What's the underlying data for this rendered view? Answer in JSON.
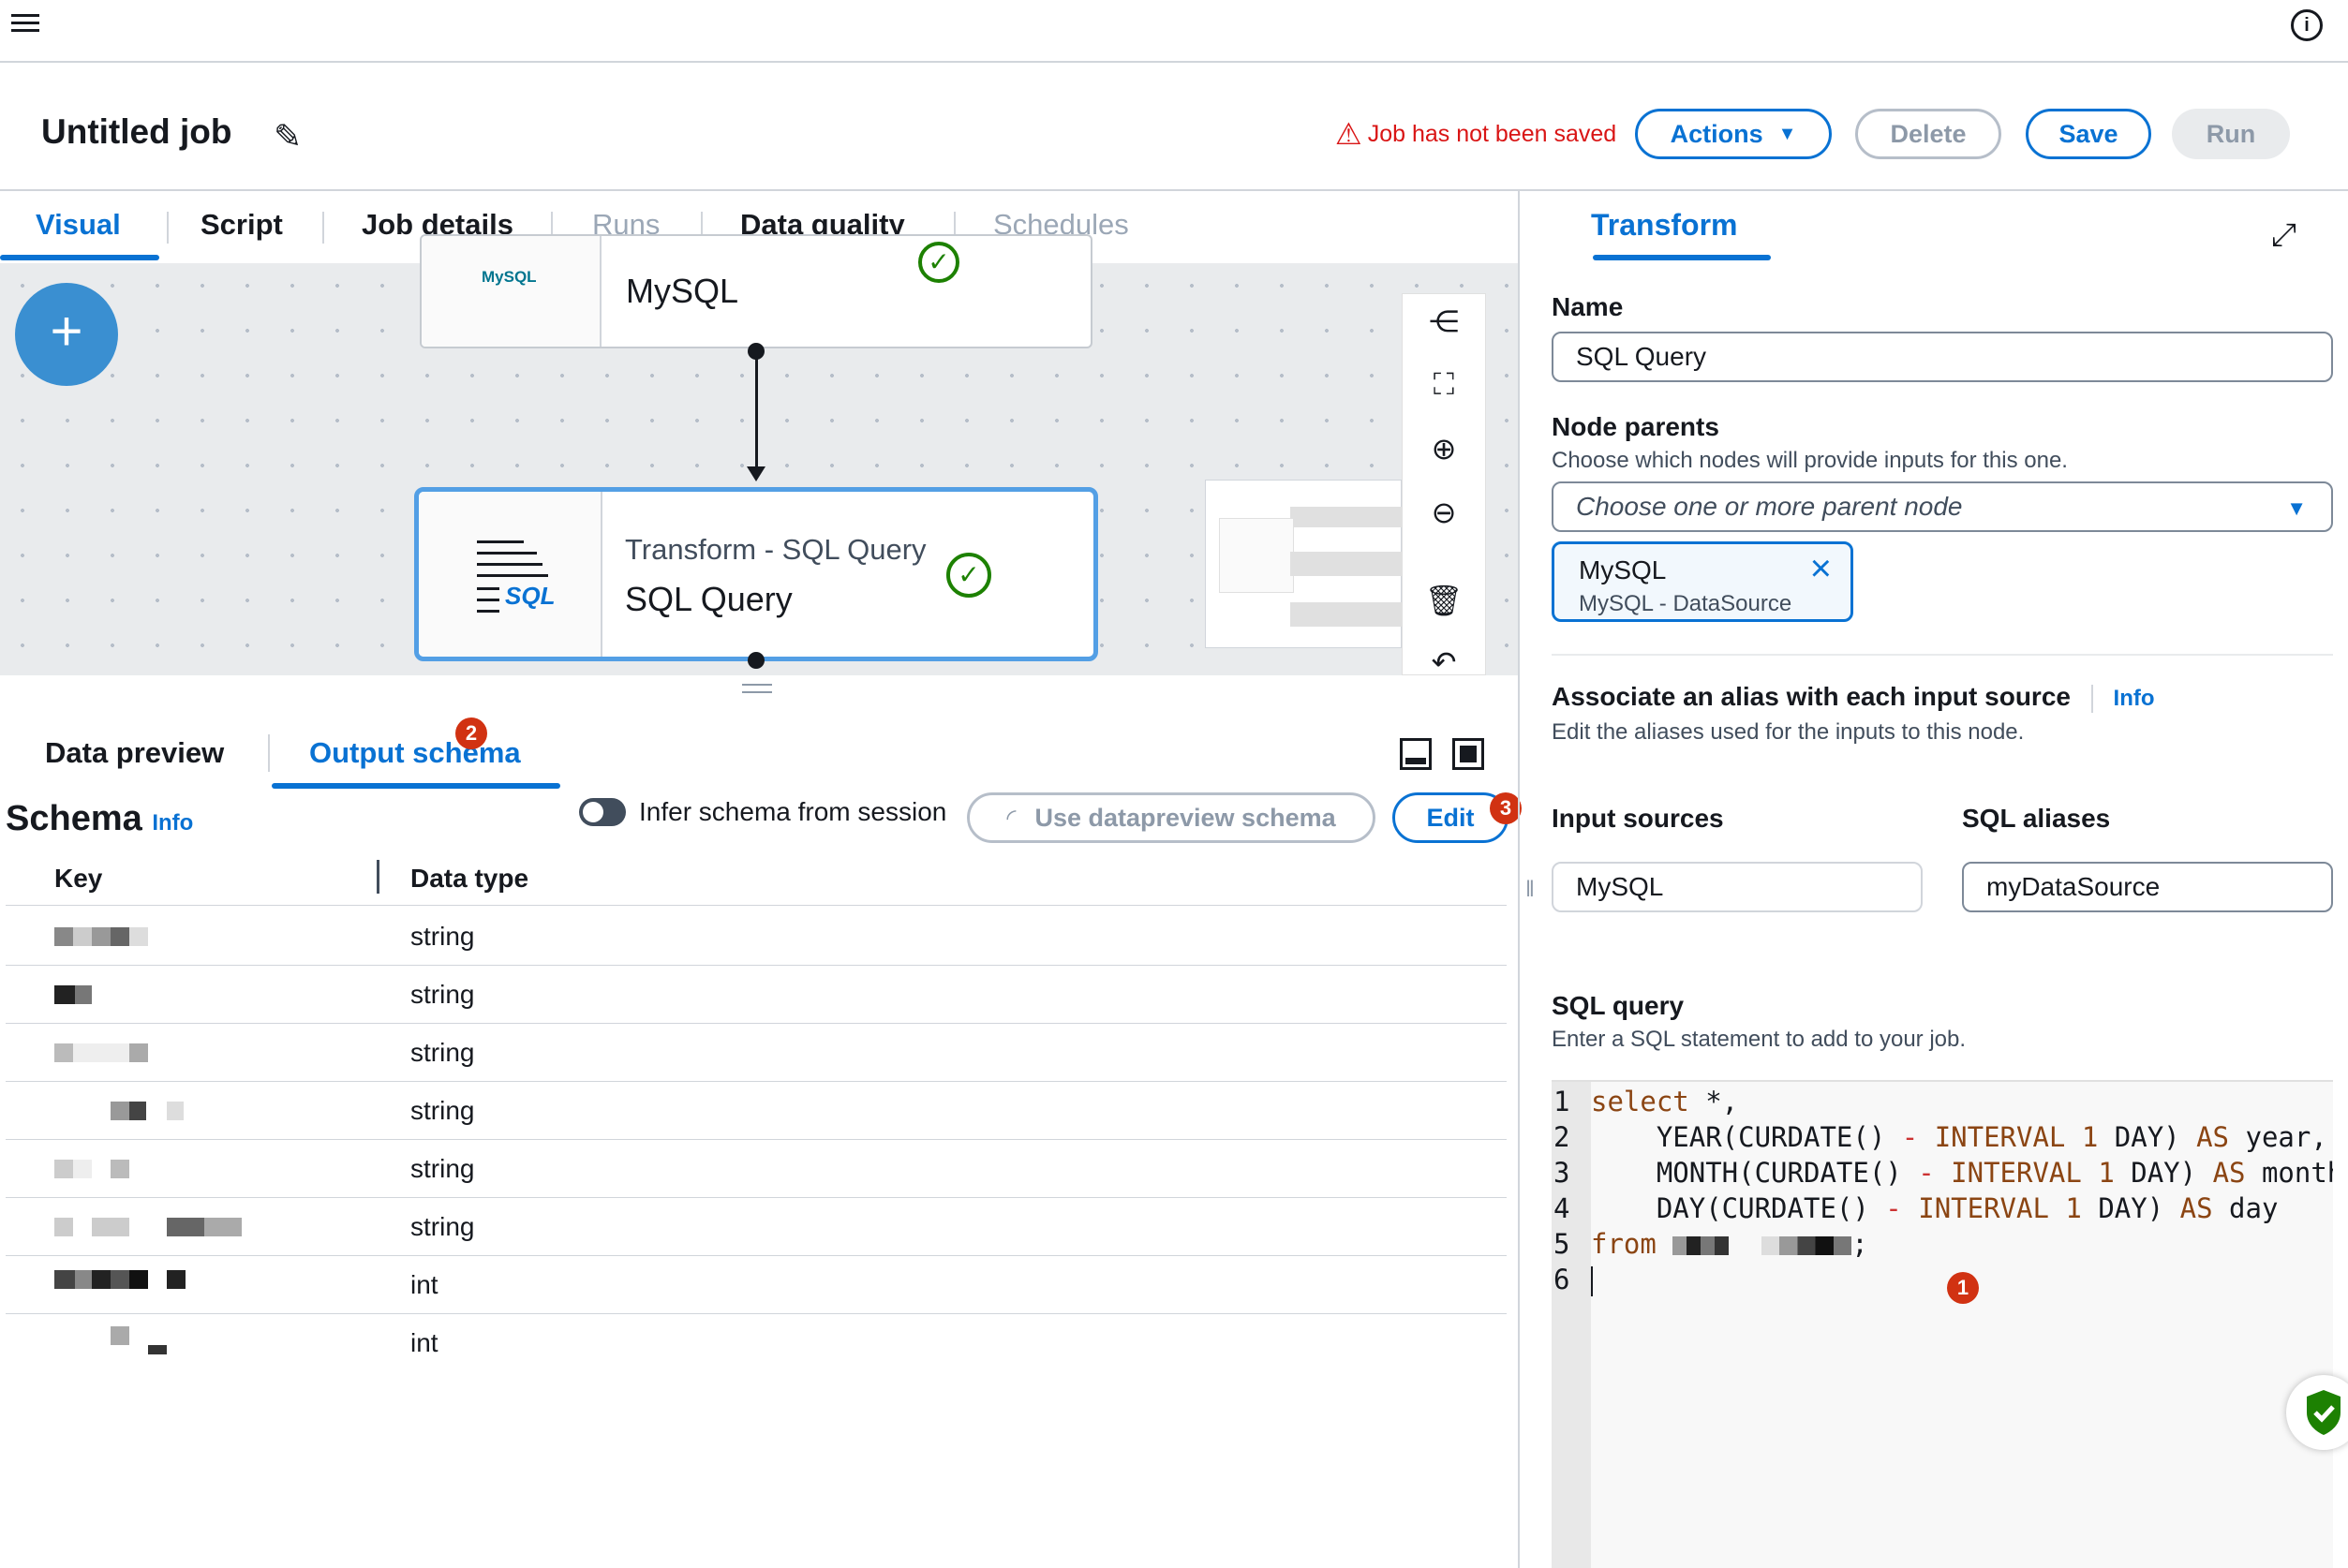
{
  "header": {
    "job_title": "Untitled job",
    "warning": "Job has not been saved",
    "actions_label": "Actions",
    "delete_label": "Delete",
    "save_label": "Save",
    "run_label": "Run"
  },
  "tabs": [
    "Visual",
    "Script",
    "Job details",
    "Runs",
    "Data quality",
    "Schedules"
  ],
  "canvas": {
    "node1": {
      "logo": "MySQL",
      "label": "MySQL"
    },
    "node2": {
      "title": "Transform - SQL Query",
      "label": "SQL Query",
      "icon_text": "SQL"
    }
  },
  "bottom": {
    "tabs": [
      "Data preview",
      "Output schema"
    ],
    "schema_title": "Schema",
    "info_label": "Info",
    "infer_label": "Infer schema from session",
    "use_preview_label": "Use datapreview schema",
    "edit_label": "Edit",
    "columns": [
      "Key",
      "Data type"
    ],
    "rows": [
      "string",
      "string",
      "string",
      "string",
      "string",
      "string",
      "int",
      "int"
    ],
    "badges": [
      "1",
      "2",
      "3"
    ]
  },
  "transform": {
    "tab": "Transform",
    "name_label": "Name",
    "name_value": "SQL Query",
    "parents_label": "Node parents",
    "parents_desc": "Choose which nodes will provide inputs for this one.",
    "parents_placeholder": "Choose one or more parent node",
    "token_title": "MySQL",
    "token_sub": "MySQL - DataSource",
    "alias_label": "Associate an alias with each input source",
    "alias_info": "Info",
    "alias_desc": "Edit the aliases used for the inputs to this node.",
    "input_sources_label": "Input sources",
    "sql_aliases_label": "SQL aliases",
    "input_source_value": "MySQL",
    "alias_value": "myDataSource",
    "sql_label": "SQL query",
    "sql_desc": "Enter a SQL statement to add to your job."
  },
  "code": {
    "line_numbers": [
      "1",
      "2",
      "3",
      "4",
      "5",
      "6"
    ],
    "l1_kw": "select",
    "l1_rest": " *,",
    "fn_year": "YEAR(CURDATE()",
    "fn_month": "MONTH(CURDATE()",
    "fn_day": "DAY(CURDATE()",
    "minus": "-",
    "interval": "INTERVAL",
    "one": "1",
    "day_unit": "DAY)",
    "as": "AS",
    "alias_year": "year,",
    "alias_month": "month,",
    "alias_day": "day",
    "from_kw": "from",
    "semicolon": ";"
  },
  "colors": {
    "accent": "#0972d3",
    "error": "#d91515",
    "success": "#1d8102",
    "badge": "#d13212"
  },
  "icons": [
    "menu-icon",
    "info-icon",
    "edit-pencil-icon",
    "warning-icon",
    "plus-icon",
    "check-circle-icon",
    "layout-icon",
    "fit-view-icon",
    "zoom-in-icon",
    "zoom-out-icon",
    "trash-icon",
    "undo-icon",
    "expand-icon",
    "close-icon",
    "shield-icon"
  ]
}
